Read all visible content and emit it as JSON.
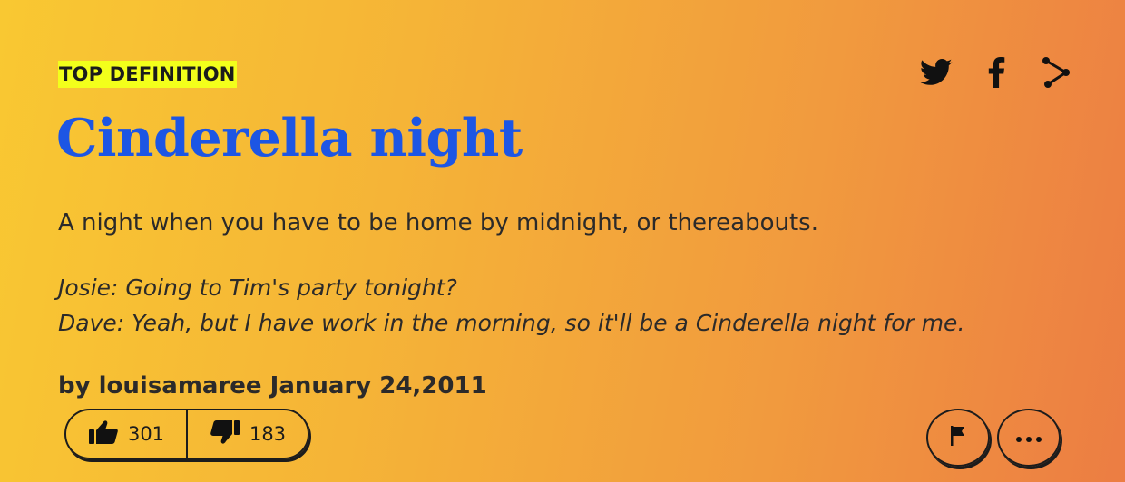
{
  "badge": "TOP DEFINITION",
  "word": "Cinderella night",
  "meaning": "A night when you have to be home by midnight, or thereabouts.",
  "example": {
    "line1": "Josie: Going to Tim's party tonight?",
    "line2": "Dave: Yeah, but I have work in the morning, so it'll be a Cinderella night for me."
  },
  "contributor": {
    "prefix": "by",
    "author": "louisamaree",
    "date": "January 24,2011"
  },
  "votes": {
    "up": "301",
    "down": "183"
  },
  "share": {
    "icons": [
      "twitter-icon",
      "facebook-icon",
      "share-icon"
    ]
  },
  "actions": {
    "icons": [
      "flag-icon",
      "more-icon"
    ]
  },
  "colors": {
    "word": "#1d56e4",
    "badge_bg": "#f3ff1b",
    "text": "#2b2a2a",
    "gradient_start": "#f9c832",
    "gradient_end": "#ec7d43"
  }
}
